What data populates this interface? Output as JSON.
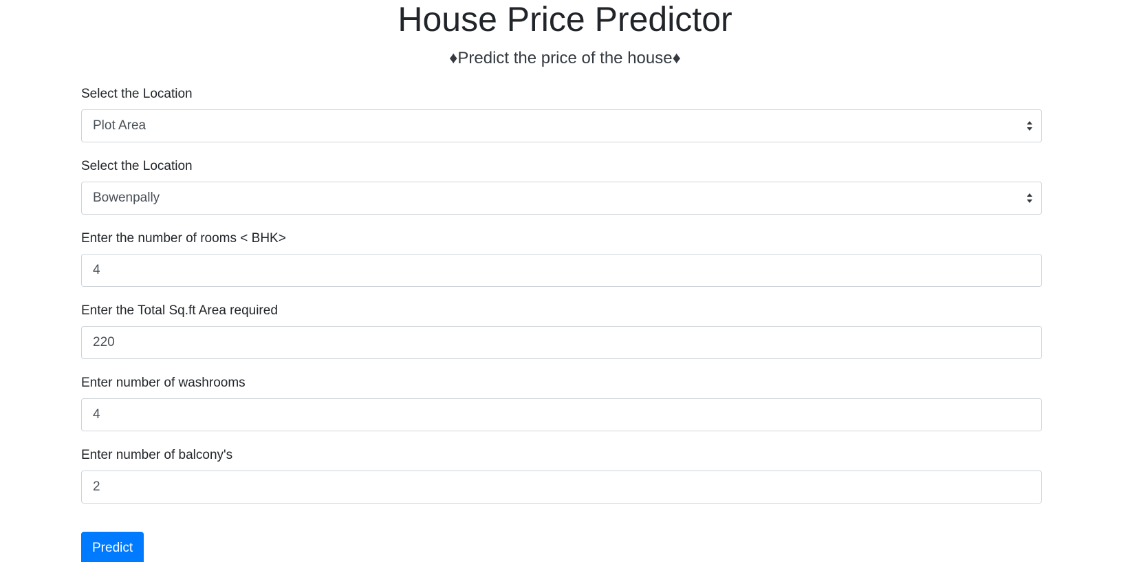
{
  "header": {
    "title": "House Price Predictor",
    "subtitle": "♦Predict the price of the house♦"
  },
  "form": {
    "location_type": {
      "label": "Select the Location",
      "selected": "Plot Area"
    },
    "location": {
      "label": "Select the Location",
      "selected": "Bowenpally"
    },
    "rooms": {
      "label": "Enter the number of rooms < BHK>",
      "value": "4"
    },
    "sqft": {
      "label": "Enter the Total Sq.ft Area required",
      "value": "220"
    },
    "washrooms": {
      "label": "Enter number of washrooms",
      "value": "4"
    },
    "balcony": {
      "label": "Enter number of balcony's",
      "value": "2"
    },
    "submit_label": "Predict"
  },
  "colors": {
    "primary": "#007bff",
    "border": "#ced4da",
    "text": "#212529"
  }
}
